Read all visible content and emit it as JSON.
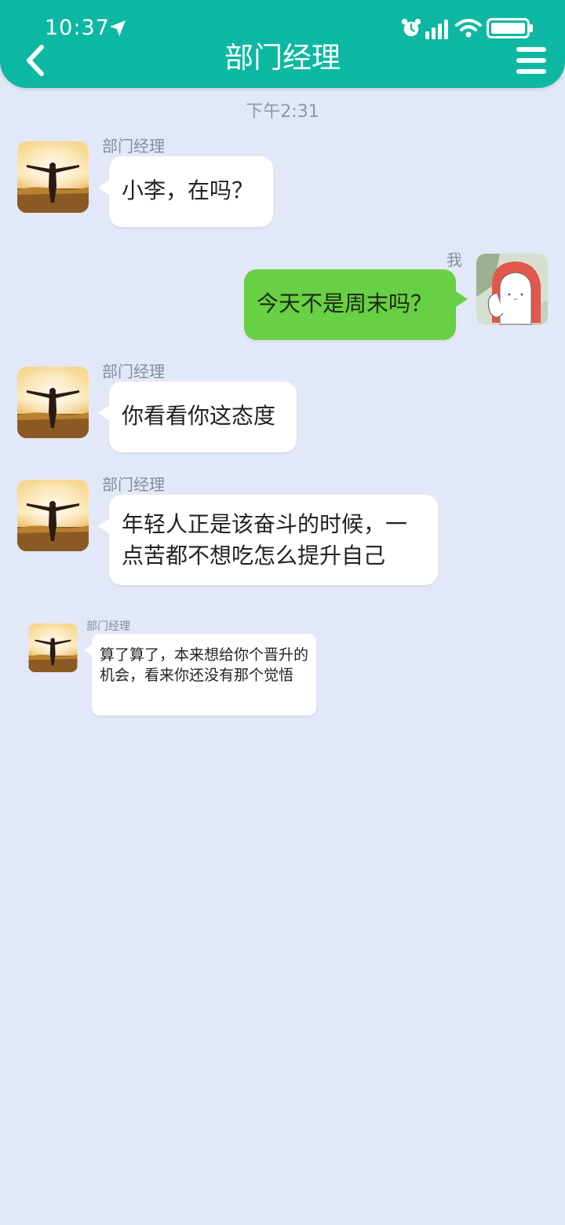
{
  "status_bar": {
    "time": "10:37"
  },
  "header": {
    "title": "部门经理"
  },
  "chat": {
    "timestamp": "下午2:31",
    "messages": [
      {
        "sender": "部门经理",
        "text": "小李，在吗？"
      },
      {
        "sender": "我",
        "text": "今天不是周末吗？"
      },
      {
        "sender": "部门经理",
        "text": "你看看你这态度"
      },
      {
        "sender": "部门经理",
        "text": "年轻人正是该奋斗的时候，一点苦都不想吃怎么提升自己"
      },
      {
        "sender": "部门经理",
        "text": "算了算了，本来想给你个晋升的机会，看来你还没有那个觉悟"
      }
    ]
  },
  "colors": {
    "header_bg": "#0cb8a1",
    "chat_bg": "#e2e8f7",
    "my_bubble": "#68d044",
    "other_bubble": "#ffffff"
  },
  "icons": {
    "back": "chevron-left-icon",
    "menu": "hamburger-menu-icon",
    "location": "location-arrow-icon",
    "alarm": "alarm-clock-icon",
    "signal": "signal-icon",
    "wifi": "wifi-icon",
    "battery": "battery-icon"
  }
}
